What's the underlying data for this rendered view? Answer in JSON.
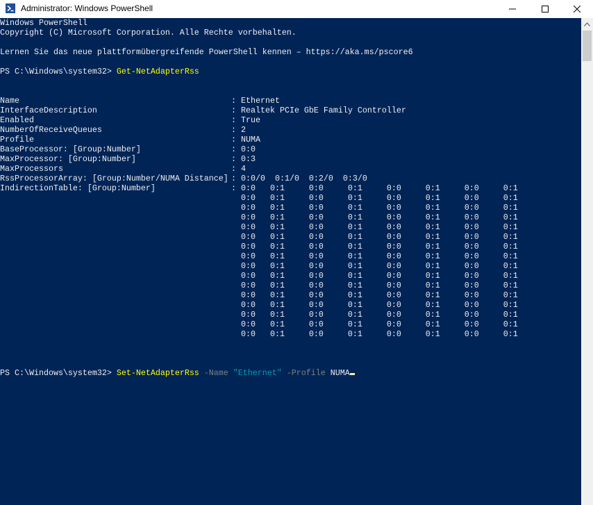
{
  "window": {
    "title": "Administrator: Windows PowerShell",
    "icon": "powershell-icon",
    "controls": [
      "minimize-icon",
      "maximize-icon",
      "close-icon"
    ]
  },
  "console": {
    "colors": {
      "background": "#012456",
      "foreground": "#eeedf0",
      "command": "#ffff00",
      "parameter": "#808080",
      "string": "#00a0b4"
    },
    "header": [
      "Windows PowerShell",
      "Copyright (C) Microsoft Corporation. Alle Rechte vorbehalten.",
      "",
      "Lernen Sie das neue plattformübergreifende PowerShell kennen – https://aka.ms/pscore6"
    ],
    "prompt": "PS C:\\Windows\\system32> ",
    "command1": "Get-NetAdapterRss",
    "properties": [
      {
        "name": "Name",
        "value": "Ethernet"
      },
      {
        "name": "InterfaceDescription",
        "value": "Realtek PCIe GbE Family Controller"
      },
      {
        "name": "Enabled",
        "value": "True"
      },
      {
        "name": "NumberOfReceiveQueues",
        "value": "2"
      },
      {
        "name": "Profile",
        "value": "NUMA"
      },
      {
        "name": "BaseProcessor: [Group:Number]",
        "value": "0:0"
      },
      {
        "name": "MaxProcessor: [Group:Number]",
        "value": "0:3"
      },
      {
        "name": "MaxProcessors",
        "value": "4"
      },
      {
        "name": "RssProcessorArray: [Group:Number/NUMA Distance]",
        "value": "0:0/0  0:1/0  0:2/0  0:3/0"
      }
    ],
    "indirection_label": "IndirectionTable: [Group:Number]",
    "indirection_rows": [
      "0:0   0:1     0:0     0:1     0:0     0:1     0:0     0:1",
      "0:0   0:1     0:0     0:1     0:0     0:1     0:0     0:1",
      "0:0   0:1     0:0     0:1     0:0     0:1     0:0     0:1",
      "0:0   0:1     0:0     0:1     0:0     0:1     0:0     0:1",
      "0:0   0:1     0:0     0:1     0:0     0:1     0:0     0:1",
      "0:0   0:1     0:0     0:1     0:0     0:1     0:0     0:1",
      "0:0   0:1     0:0     0:1     0:0     0:1     0:0     0:1",
      "0:0   0:1     0:0     0:1     0:0     0:1     0:0     0:1",
      "0:0   0:1     0:0     0:1     0:0     0:1     0:0     0:1",
      "0:0   0:1     0:0     0:1     0:0     0:1     0:0     0:1",
      "0:0   0:1     0:0     0:1     0:0     0:1     0:0     0:1",
      "0:0   0:1     0:0     0:1     0:0     0:1     0:0     0:1",
      "0:0   0:1     0:0     0:1     0:0     0:1     0:0     0:1",
      "0:0   0:1     0:0     0:1     0:0     0:1     0:0     0:1",
      "0:0   0:1     0:0     0:1     0:0     0:1     0:0     0:1",
      "0:0   0:1     0:0     0:1     0:0     0:1     0:0     0:1"
    ],
    "command2": {
      "cmdlet": "Set-NetAdapterRss",
      "param1": "-Name",
      "string1": "\"Ethernet\"",
      "param2": "-Profile",
      "arg2": "NUMA"
    }
  }
}
